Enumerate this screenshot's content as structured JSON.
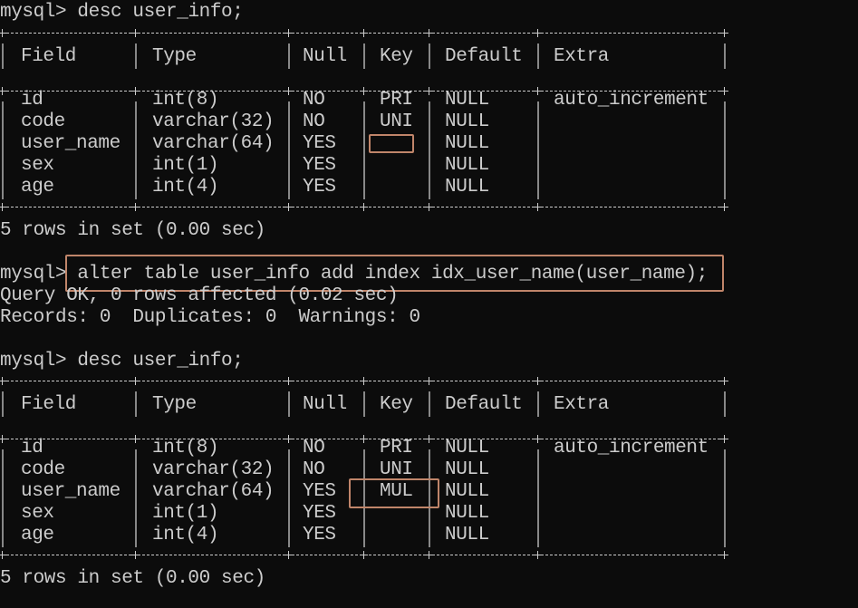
{
  "terminal": {
    "prompt": "mysql>",
    "commands": [
      {
        "text": " desc user_info;"
      },
      {
        "text": " alter table user_info add index idx_user_name(user_name);"
      },
      {
        "text": " desc user_info;"
      }
    ],
    "alter_output": [
      "Query OK, 0 rows affected (0.02 sec)",
      "Records: 0  Duplicates: 0  Warnings: 0"
    ],
    "tables": [
      {
        "headers": [
          "Field",
          "Type",
          "Null",
          "Key",
          "Default",
          "Extra"
        ],
        "rows": [
          [
            "id",
            "int(8)",
            "NO",
            "PRI",
            "NULL",
            "auto_increment"
          ],
          [
            "code",
            "varchar(32)",
            "NO",
            "UNI",
            "NULL",
            ""
          ],
          [
            "user_name",
            "varchar(64)",
            "YES",
            "",
            "NULL",
            ""
          ],
          [
            "sex",
            "int(1)",
            "YES",
            "",
            "NULL",
            ""
          ],
          [
            "age",
            "int(4)",
            "YES",
            "",
            "NULL",
            ""
          ]
        ],
        "footer": "5 rows in set (0.00 sec)"
      },
      {
        "headers": [
          "Field",
          "Type",
          "Null",
          "Key",
          "Default",
          "Extra"
        ],
        "rows": [
          [
            "id",
            "int(8)",
            "NO",
            "PRI",
            "NULL",
            "auto_increment"
          ],
          [
            "code",
            "varchar(32)",
            "NO",
            "UNI",
            "NULL",
            ""
          ],
          [
            "user_name",
            "varchar(64)",
            "YES",
            "MUL",
            "NULL",
            ""
          ],
          [
            "sex",
            "int(1)",
            "YES",
            "",
            "NULL",
            ""
          ],
          [
            "age",
            "int(4)",
            "YES",
            "",
            "NULL",
            ""
          ]
        ],
        "footer": "5 rows in set (0.00 sec)"
      }
    ],
    "highlight_color": "#c0856a",
    "background_color": "#0c0c0c",
    "text_color": "#cccccc"
  }
}
